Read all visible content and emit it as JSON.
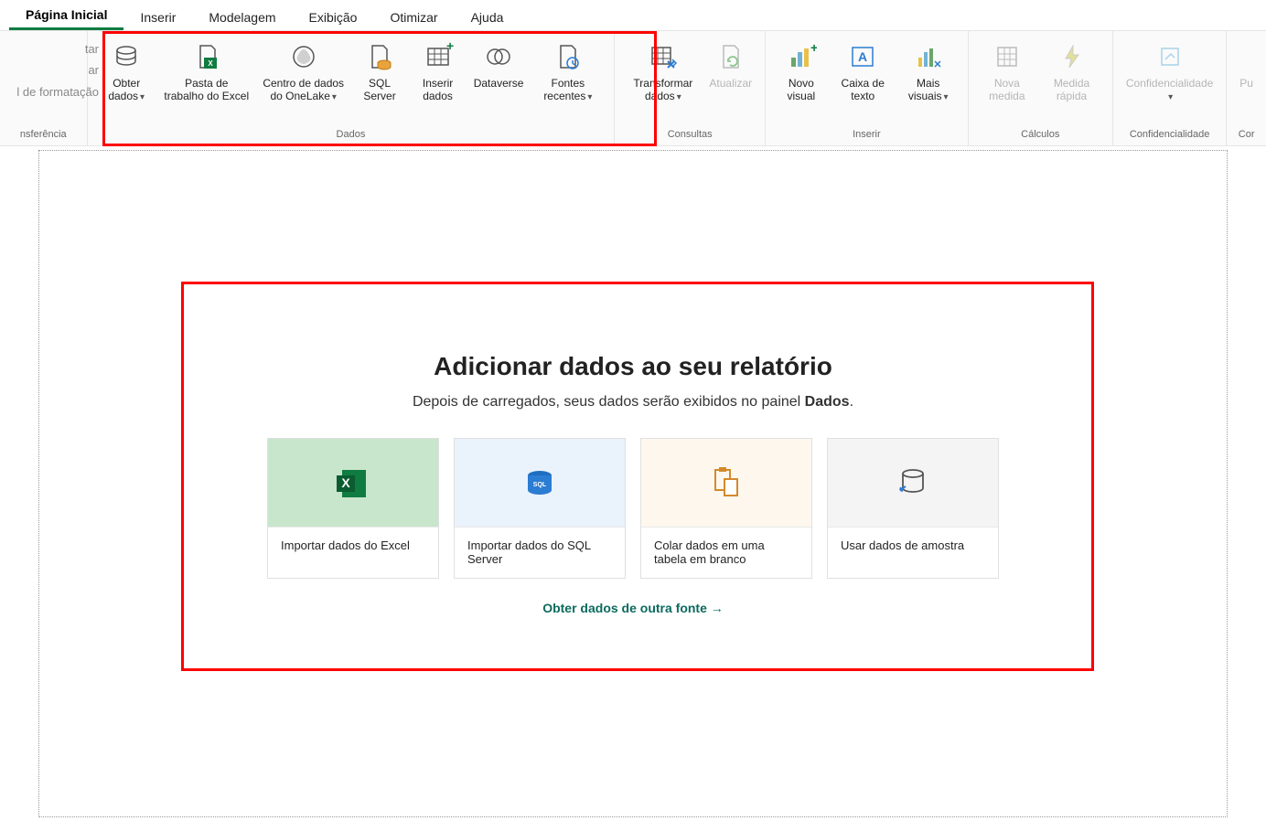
{
  "tabs": {
    "home": "Página Inicial",
    "insert": "Inserir",
    "modeling": "Modelagem",
    "view": "Exibição",
    "optimize": "Otimizar",
    "help": "Ajuda"
  },
  "ribbon": {
    "clipboard": {
      "cut_partial": "tar",
      "copy_partial": "ar",
      "formatpainter_partial": "l de formatação",
      "group_label_partial": "nsferência"
    },
    "data": {
      "get_data": "Obter dados",
      "excel_workbook": "Pasta de trabalho do Excel",
      "onelake_hub": "Centro de dados do OneLake",
      "sql_server": "SQL Server",
      "enter_data": "Inserir dados",
      "dataverse": "Dataverse",
      "recent_sources": "Fontes recentes",
      "group_label": "Dados"
    },
    "queries": {
      "transform_data": "Transformar dados",
      "refresh": "Atualizar",
      "group_label": "Consultas"
    },
    "insert": {
      "new_visual": "Novo visual",
      "text_box": "Caixa de texto",
      "more_visuals": "Mais visuais",
      "group_label": "Inserir"
    },
    "calc": {
      "new_measure": "Nova medida",
      "quick_measure": "Medida rápida",
      "group_label": "Cálculos"
    },
    "sensitivity": {
      "label": "Confidencialidade",
      "group_label": "Confidencialidade"
    },
    "share": {
      "partial": "Pu",
      "group_partial": "Cor"
    }
  },
  "canvas": {
    "title": "Adicionar dados ao seu relatório",
    "subtitle_pre": "Depois de carregados, seus dados serão exibidos no painel ",
    "subtitle_bold": "Dados",
    "subtitle_post": ".",
    "cards": {
      "excel": "Importar dados do Excel",
      "sql": "Importar dados do SQL Server",
      "paste": "Colar dados em uma tabela em branco",
      "sample": "Usar dados de amostra"
    },
    "other_link": "Obter dados de outra fonte →"
  }
}
